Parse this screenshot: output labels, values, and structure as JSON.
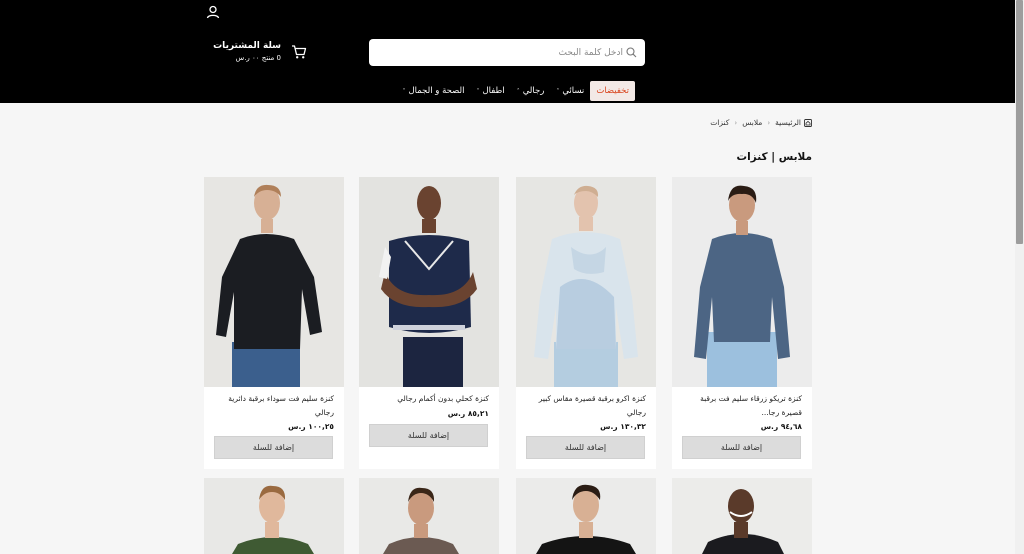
{
  "header": {
    "cart_title": "سلة المشتريات",
    "cart_summary": "0 منتج ٠٠ ر.س",
    "search_placeholder": "أدخل كلمة البحث"
  },
  "nav": {
    "items": [
      {
        "label": "تخفيضات",
        "active": true,
        "has_chevron": false
      },
      {
        "label": "نسائي",
        "chevron": "˄"
      },
      {
        "label": "رجالي",
        "chevron": "˄"
      },
      {
        "label": "اطفال",
        "chevron": "˄"
      },
      {
        "label": "الصحة و الجمال",
        "chevron": "˄"
      }
    ]
  },
  "breadcrumb": {
    "home": "الرئيسية",
    "items": [
      "ملابس",
      "كنزات"
    ],
    "separator": "‹"
  },
  "page_title": "ملابس | كنزات",
  "products": [
    {
      "name": "كنزة تريكو زرقاء سليم فت برقبة قصيرة رجا...",
      "price": "٩٤,٦٨ ر.س",
      "button": "إضافة للسلة",
      "shirt_color": "#4c6584",
      "pants_color": "#9cc0de",
      "bg": "#ececec"
    },
    {
      "name": "كنزة اكرو برقبة قصيرة مقاس كبير رجالي",
      "price": "١٣٠,٣٢ ر.س",
      "button": "إضافة للسلة",
      "shirt_color": "#d9e4ec",
      "pants_color": "#b4cde0",
      "bg": "#e6e6e3"
    },
    {
      "name": "كنزة كحلي بدون أكمام رجالي",
      "price": "٨٥,٢١ ر.س",
      "button": "إضافة للسلة",
      "shirt_color": "#1e2a4a",
      "pants_color": "#1c2540",
      "bg": "#e3e3e0"
    },
    {
      "name": "كنزة سليم فت سوداء برقبة دائرية رجالي",
      "price": "١٠٠,٢٥ ر.س",
      "button": "إضافة للسلة",
      "shirt_color": "#1b1d22",
      "pants_color": "#3b5f8d",
      "bg": "#e7e6e3"
    },
    {
      "shirt_color": "#1b1b1f",
      "bg": "#ececea"
    },
    {
      "shirt_color": "#141414",
      "bg": "#ebebea"
    },
    {
      "shirt_color": "#6b5a52",
      "bg": "#e9e9e7"
    },
    {
      "shirt_color": "#3f5a33",
      "bg": "#e8e8e6"
    }
  ],
  "colors": {
    "header_bg": "#000000",
    "accent": "#d9431c",
    "page_bg": "#f6f6f6"
  }
}
